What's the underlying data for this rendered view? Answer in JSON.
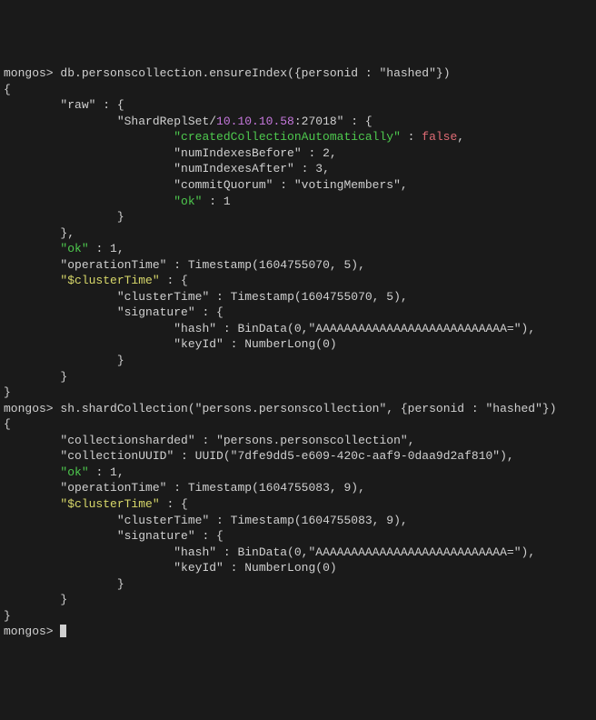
{
  "prompt": "mongos>",
  "cmd1": "db.personscollection.ensureIndex({personid : \"hashed\"})",
  "out1": {
    "raw_key": "\"raw\"",
    "shard_key": "\"ShardReplSet/",
    "shard_ip": "10.10.10.58",
    "shard_port": ":27018\"",
    "created_key": "\"createdCollectionAutomatically\"",
    "created_val": "false",
    "before_key": "\"numIndexesBefore\"",
    "before_val": "2",
    "after_key": "\"numIndexesAfter\"",
    "after_val": "3",
    "quorum_key": "\"commitQuorum\"",
    "quorum_val": "\"votingMembers\"",
    "ok_key": "\"ok\"",
    "ok_val": "1",
    "optime_key": "\"operationTime\"",
    "optime_val": "Timestamp(1604755070, 5)",
    "cluster_key": "\"$clusterTime\"",
    "ctime_key": "\"clusterTime\"",
    "ctime_val": "Timestamp(1604755070, 5)",
    "sig_key": "\"signature\"",
    "hash_key": "\"hash\"",
    "hash_val": "BinData(0,\"AAAAAAAAAAAAAAAAAAAAAAAAAAA=\")",
    "keyid_key": "\"keyId\"",
    "keyid_val": "NumberLong(0)"
  },
  "cmd2": "sh.shardCollection(\"persons.personscollection\", {personid : \"hashed\"})",
  "out2": {
    "sharded_key": "\"collectionsharded\"",
    "sharded_val": "\"persons.personscollection\"",
    "uuid_key": "\"collectionUUID\"",
    "uuid_val": "UUID(\"7dfe9dd5-e609-420c-aaf9-0daa9d2af810\")",
    "ok_key": "\"ok\"",
    "ok_val": "1",
    "optime_key": "\"operationTime\"",
    "optime_val": "Timestamp(1604755083, 9)",
    "cluster_key": "\"$clusterTime\"",
    "ctime_key": "\"clusterTime\"",
    "ctime_val": "Timestamp(1604755083, 9)",
    "sig_key": "\"signature\"",
    "hash_key": "\"hash\"",
    "hash_val": "BinData(0,\"AAAAAAAAAAAAAAAAAAAAAAAAAAA=\")",
    "keyid_key": "\"keyId\"",
    "keyid_val": "NumberLong(0)"
  }
}
